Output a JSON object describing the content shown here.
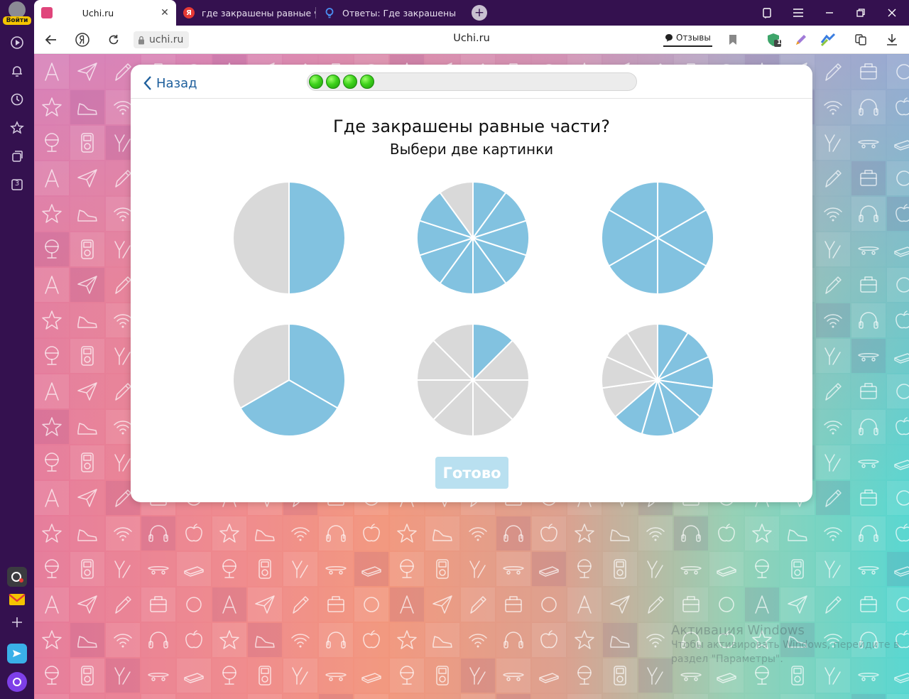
{
  "browser": {
    "login_label": "Войти",
    "sidebar_tab_count": "3",
    "tabs": [
      {
        "title": "Uchi.ru",
        "active": true,
        "favicon": "uchi-favicon"
      },
      {
        "title": "где закрашены равные ча",
        "active": false,
        "favicon": "yandex-favicon"
      },
      {
        "title": "Ответы: Где закрашены ра",
        "active": false,
        "favicon": "answers-favicon"
      }
    ],
    "favicon_yandex_letter": "Я",
    "address": "uchi.ru",
    "page_title": "Uchi.ru",
    "reviews_label": "Отзывы",
    "shield_badge": "1"
  },
  "task": {
    "back_label": "Назад",
    "progress_done": 4,
    "question": "Где закрашены равные части?",
    "instruction": "Выбери две картинки",
    "done_label": "Готово"
  },
  "pies": [
    {
      "sectors": [
        {
          "fraction": 0.5,
          "shaded": true
        },
        {
          "fraction": 0.5,
          "shaded": false
        }
      ]
    },
    {
      "sectors": [
        {
          "fraction": 0.1,
          "shaded": true
        },
        {
          "fraction": 0.1,
          "shaded": true
        },
        {
          "fraction": 0.1,
          "shaded": true
        },
        {
          "fraction": 0.1,
          "shaded": true
        },
        {
          "fraction": 0.1,
          "shaded": true
        },
        {
          "fraction": 0.1,
          "shaded": true
        },
        {
          "fraction": 0.1,
          "shaded": true
        },
        {
          "fraction": 0.1,
          "shaded": true
        },
        {
          "fraction": 0.1,
          "shaded": true
        },
        {
          "fraction": 0.1,
          "shaded": false
        }
      ]
    },
    {
      "sectors": [
        {
          "fraction": 0.1667,
          "shaded": true
        },
        {
          "fraction": 0.1667,
          "shaded": true
        },
        {
          "fraction": 0.1667,
          "shaded": true
        },
        {
          "fraction": 0.1667,
          "shaded": true
        },
        {
          "fraction": 0.1667,
          "shaded": true
        },
        {
          "fraction": 0.1667,
          "shaded": true
        }
      ]
    },
    {
      "sectors": [
        {
          "fraction": 0.3333,
          "shaded": true
        },
        {
          "fraction": 0.3333,
          "shaded": true
        },
        {
          "fraction": 0.3333,
          "shaded": false
        }
      ]
    },
    {
      "sectors": [
        {
          "fraction": 0.125,
          "shaded": true
        },
        {
          "fraction": 0.125,
          "shaded": false
        },
        {
          "fraction": 0.125,
          "shaded": false
        },
        {
          "fraction": 0.125,
          "shaded": false
        },
        {
          "fraction": 0.125,
          "shaded": false
        },
        {
          "fraction": 0.125,
          "shaded": false
        },
        {
          "fraction": 0.125,
          "shaded": false
        },
        {
          "fraction": 0.125,
          "shaded": false
        }
      ]
    },
    {
      "sectors": [
        {
          "fraction": 0.0909,
          "shaded": true
        },
        {
          "fraction": 0.0909,
          "shaded": true
        },
        {
          "fraction": 0.0909,
          "shaded": true
        },
        {
          "fraction": 0.0909,
          "shaded": true
        },
        {
          "fraction": 0.0909,
          "shaded": true
        },
        {
          "fraction": 0.0909,
          "shaded": true
        },
        {
          "fraction": 0.0909,
          "shaded": true
        },
        {
          "fraction": 0.0909,
          "shaded": false
        },
        {
          "fraction": 0.0909,
          "shaded": false
        },
        {
          "fraction": 0.0909,
          "shaded": false
        },
        {
          "fraction": 0.0909,
          "shaded": false
        }
      ]
    }
  ],
  "colors": {
    "shaded": "#82c2e0",
    "empty": "#d9d9d9",
    "sector_border": "#ffffff",
    "browser_frame": "#34114f",
    "accent_link": "#1e5f9c",
    "done_button": "#b9e0f0"
  },
  "background_icons": [
    "letter-a-icon",
    "paper-plane-icon",
    "pencil-icon",
    "schoolbag-icon",
    "circle-icon",
    "star-icon",
    "sneaker-icon",
    "wifi-icon",
    "headphones-icon",
    "apple-icon",
    "globe-icon",
    "ipod-icon",
    "slingshot-icon",
    "skateboard-icon",
    "book-icon"
  ],
  "watermark": {
    "line1": "Активация Windows",
    "line2": "Чтобы активировать Windows, перейдите в",
    "line3": "раздел \"Параметры\"."
  }
}
